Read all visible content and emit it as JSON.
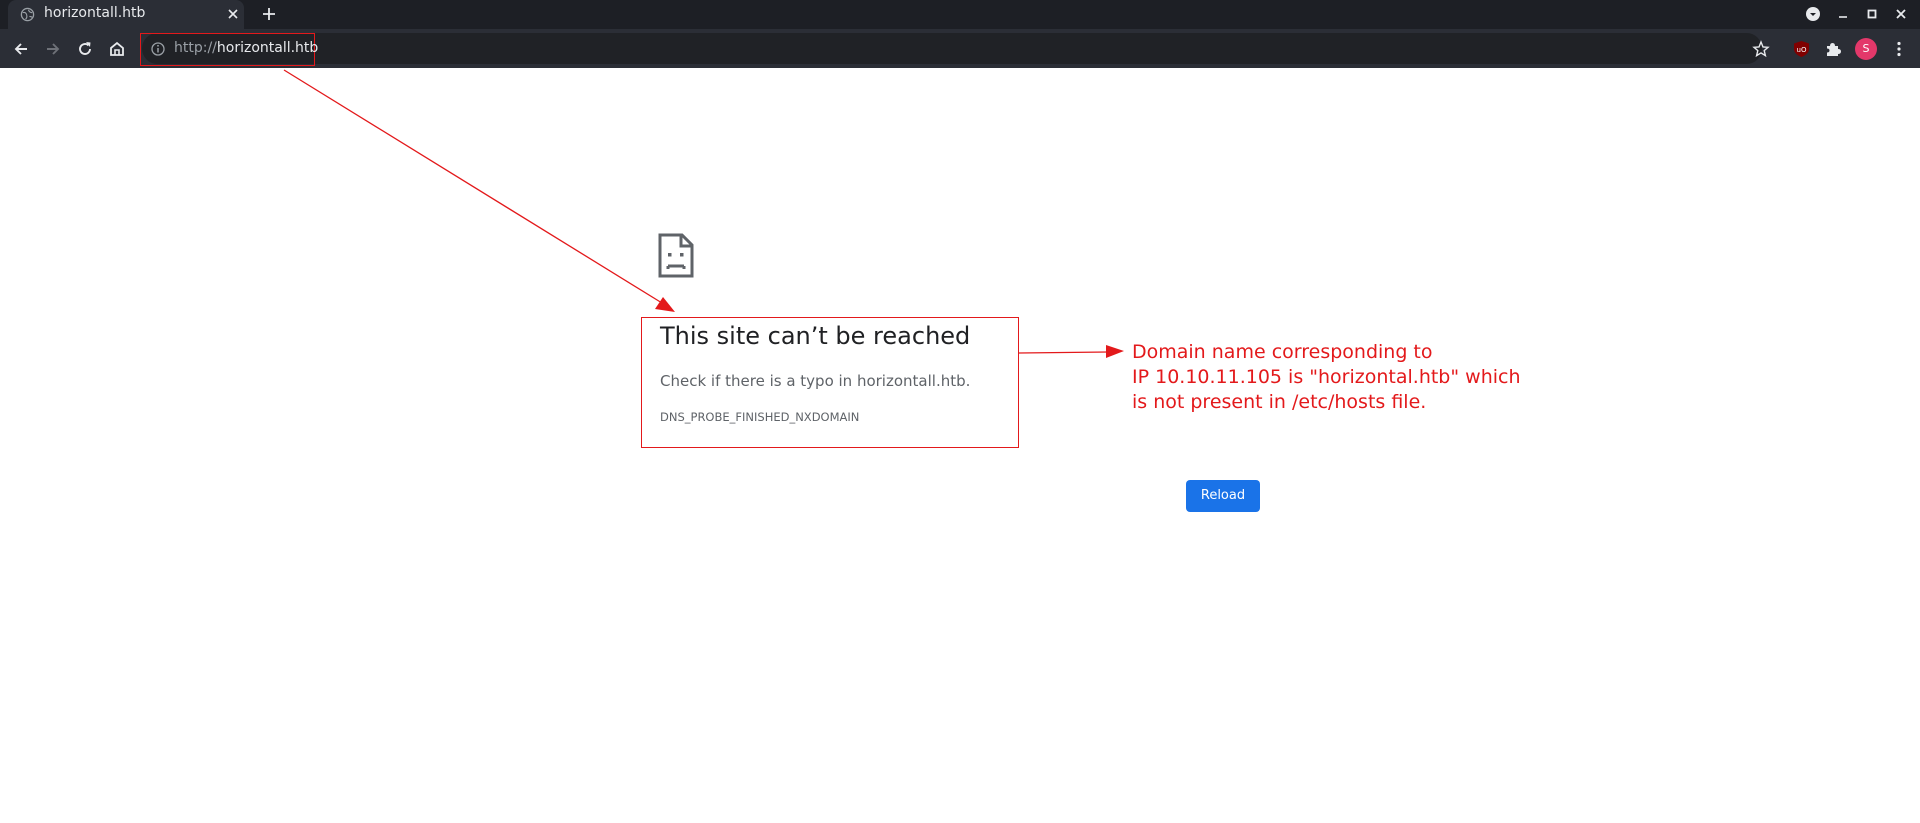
{
  "tab": {
    "title": "horizontall.htb",
    "icon": "globe-icon"
  },
  "omnibox": {
    "scheme": "http://",
    "host": "horizontall.htb",
    "icon": "info-icon"
  },
  "profile": {
    "initial": "S",
    "color": "#e3386a"
  },
  "error_page": {
    "title": "This site can’t be reached",
    "detail": "Check if there is a typo in horizontall.htb.",
    "code": "DNS_PROBE_FINISHED_NXDOMAIN",
    "reload_label": "Reload"
  },
  "annotation": {
    "lines": [
      "Domain name corresponding to",
      "IP 10.10.11.105 is \"horizontal.htb\" which",
      "is not present in /etc/hosts file."
    ],
    "color": "#e3191b"
  },
  "colors": {
    "chrome_dark": "#1d1f25",
    "toolbar": "#2b2e36",
    "button_blue": "#1a73e8",
    "annotation_red": "#e3191b"
  }
}
